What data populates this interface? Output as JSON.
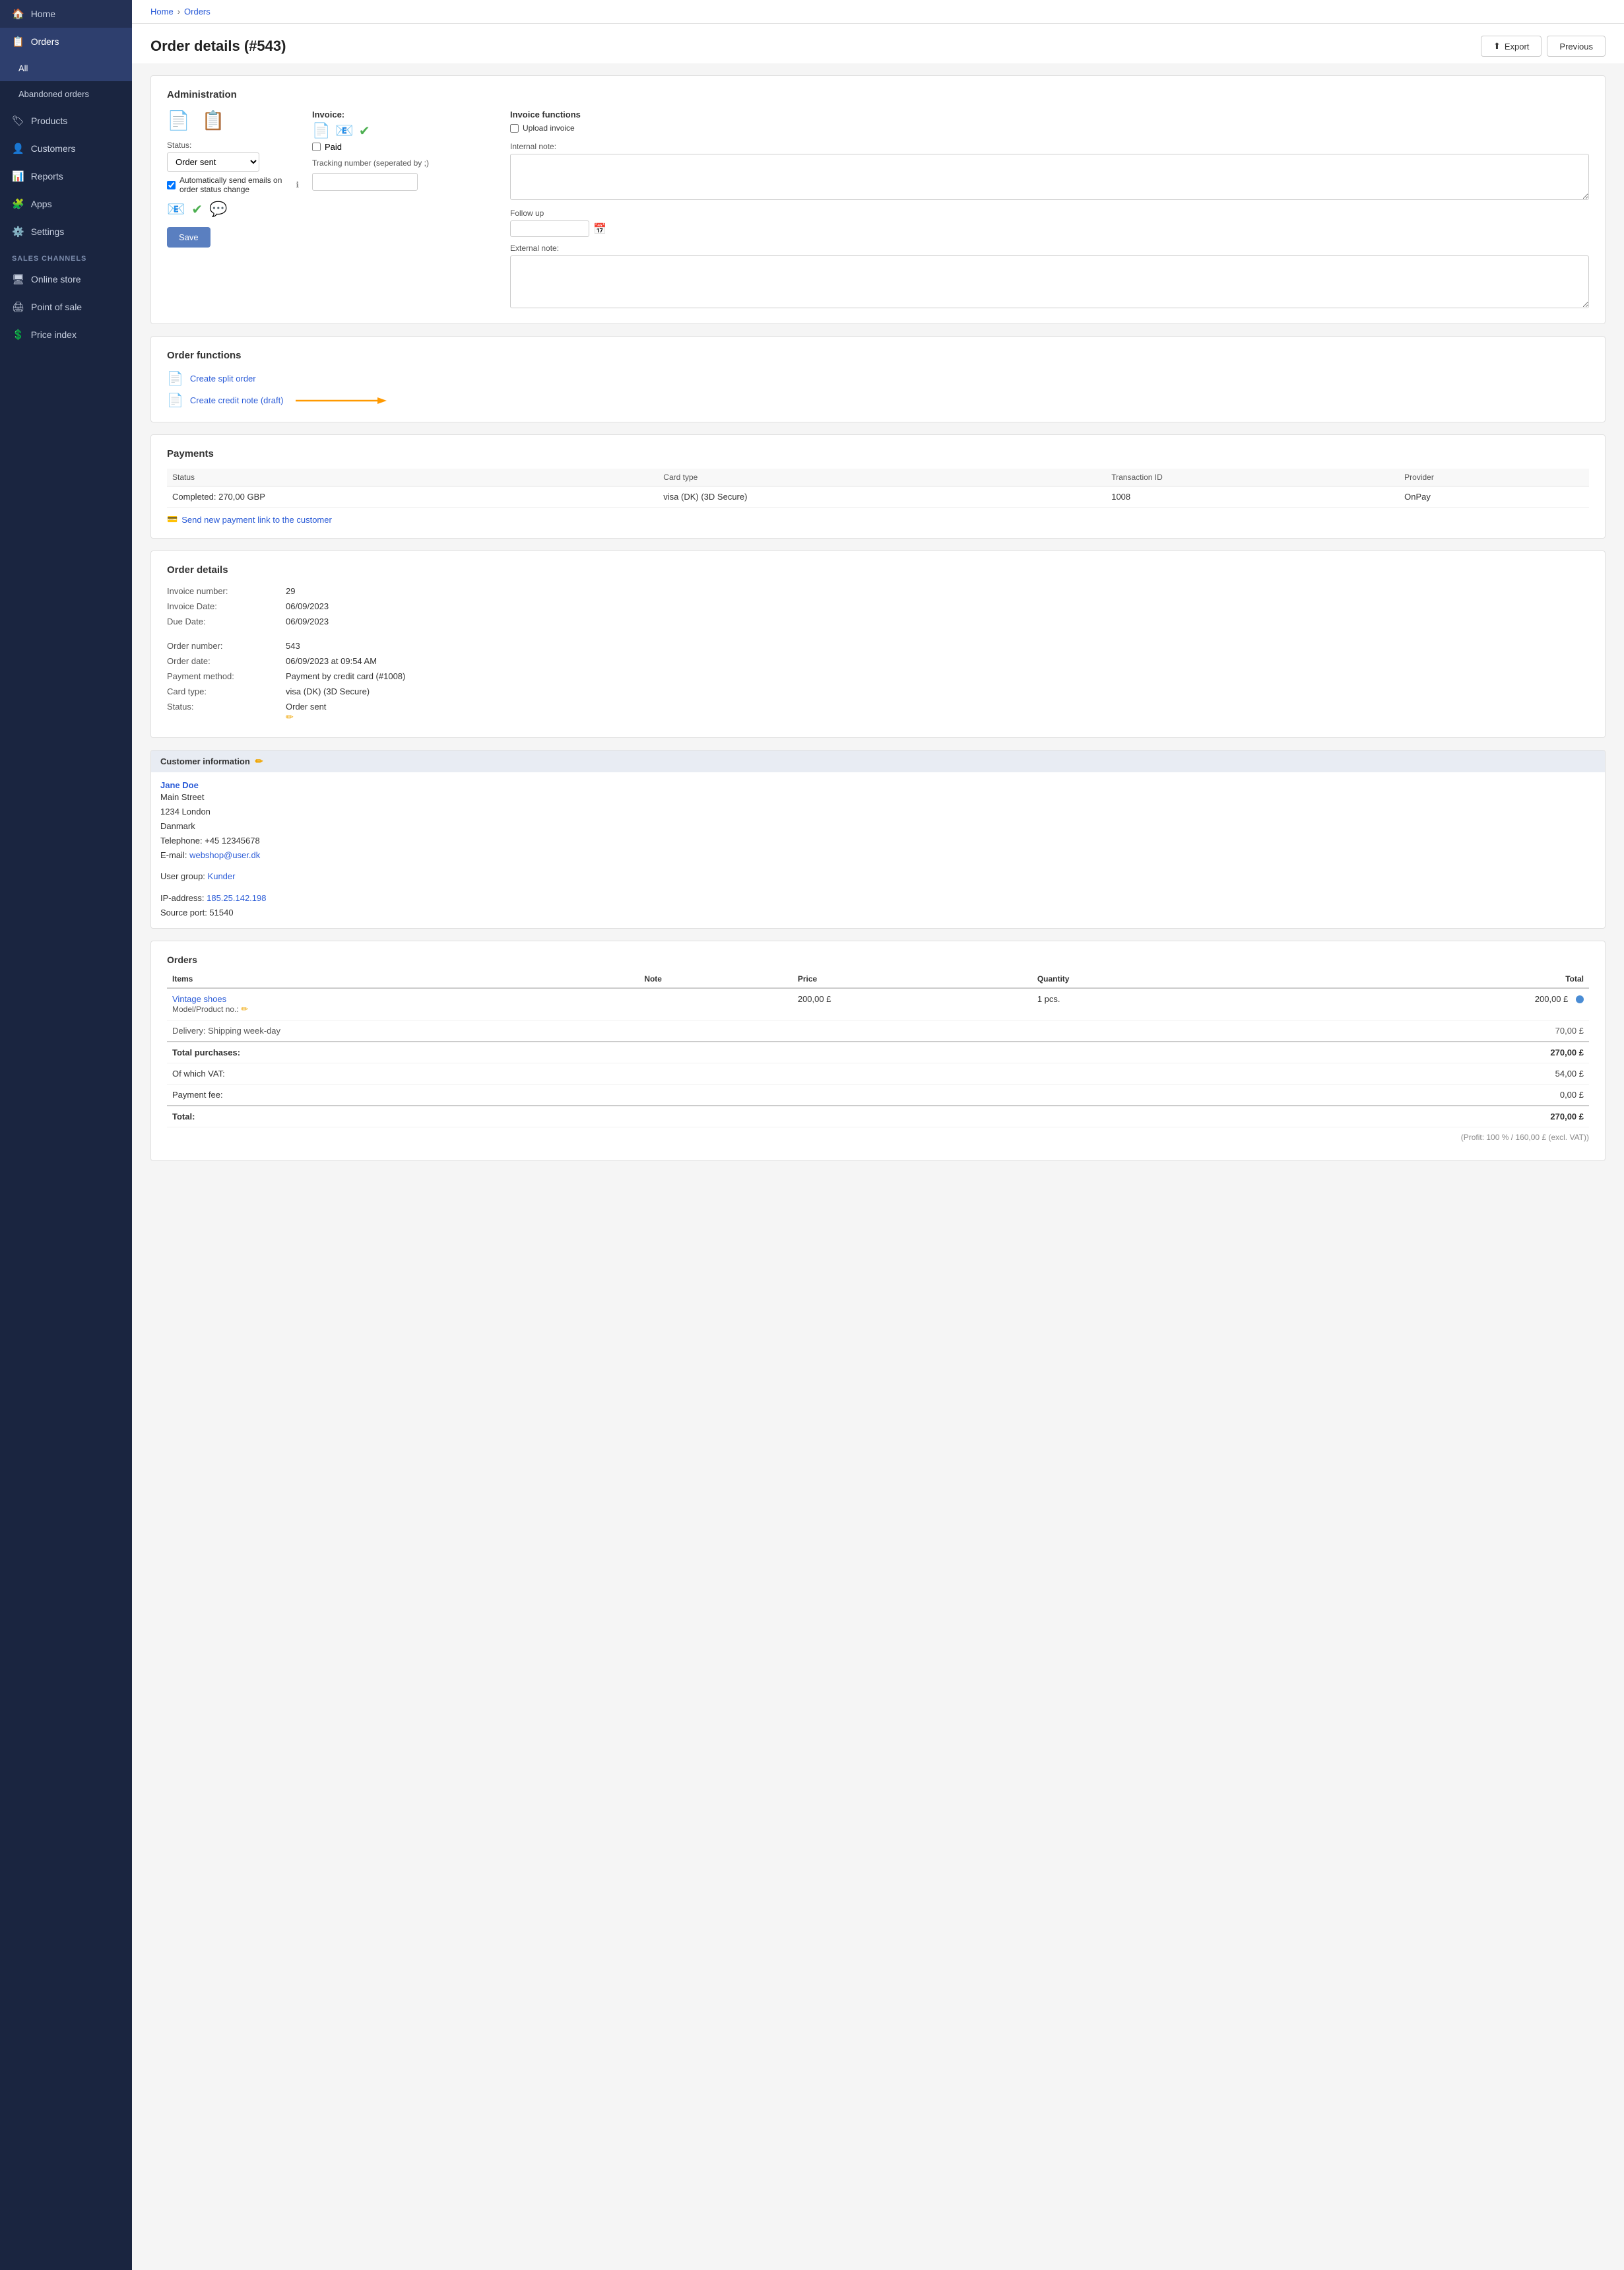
{
  "sidebar": {
    "items": [
      {
        "label": "Home",
        "icon": "🏠",
        "active": false,
        "id": "home"
      },
      {
        "label": "Orders",
        "icon": "📋",
        "active": true,
        "id": "orders"
      },
      {
        "label": "All",
        "icon": "",
        "active": true,
        "sub": true,
        "id": "orders-all"
      },
      {
        "label": "Abandoned orders",
        "icon": "",
        "active": false,
        "sub": true,
        "id": "orders-abandoned"
      },
      {
        "label": "Products",
        "icon": "🏷",
        "active": false,
        "id": "products"
      },
      {
        "label": "Customers",
        "icon": "👤",
        "active": false,
        "id": "customers"
      },
      {
        "label": "Reports",
        "icon": "📊",
        "active": false,
        "id": "reports"
      },
      {
        "label": "Apps",
        "icon": "🧩",
        "active": false,
        "id": "apps"
      },
      {
        "label": "Settings",
        "icon": "⚙️",
        "active": false,
        "id": "settings"
      }
    ],
    "sales_channels_label": "SALES CHANNELS",
    "sales_channels": [
      {
        "label": "Online store",
        "icon": "🖥",
        "id": "online-store"
      },
      {
        "label": "Point of sale",
        "icon": "🖨",
        "id": "point-of-sale"
      },
      {
        "label": "Price index",
        "icon": "💲",
        "id": "price-index"
      }
    ]
  },
  "breadcrumb": {
    "home": "Home",
    "orders": "Orders"
  },
  "header": {
    "title": "Order details (#543)",
    "export_label": "Export",
    "previous_label": "Previous"
  },
  "administration": {
    "section_title": "Administration",
    "status_label": "Status:",
    "status_value": "Order sent",
    "auto_email_label": "Automatically send emails on order status change",
    "invoice_label": "Invoice:",
    "paid_label": "Paid",
    "tracking_label": "Tracking number (seperated by ;)",
    "invoice_functions_label": "Invoice functions",
    "upload_invoice_label": "Upload invoice",
    "internal_note_label": "Internal note:",
    "follow_up_label": "Follow up",
    "external_note_label": "External note:"
  },
  "order_functions": {
    "section_title": "Order functions",
    "create_split_order": "Create split order",
    "create_credit_note": "Create credit note (draft)"
  },
  "payments": {
    "section_title": "Payments",
    "columns": [
      "Status",
      "Card type",
      "Transaction ID",
      "Provider"
    ],
    "row": {
      "status": "Completed: 270,00 GBP",
      "card_type": "visa (DK) (3D Secure)",
      "transaction_id": "1008",
      "provider": "OnPay"
    },
    "send_link_label": "Send new payment link to the customer"
  },
  "order_details": {
    "section_title": "Order details",
    "invoice_number_label": "Invoice number:",
    "invoice_number": "29",
    "invoice_date_label": "Invoice Date:",
    "invoice_date": "06/09/2023",
    "due_date_label": "Due Date:",
    "due_date": "06/09/2023",
    "order_number_label": "Order number:",
    "order_number": "543",
    "order_date_label": "Order date:",
    "order_date": "06/09/2023 at 09:54 AM",
    "payment_method_label": "Payment method:",
    "payment_method": "Payment by credit card (#1008)",
    "card_type_label": "Card type:",
    "card_type": "visa (DK) (3D Secure)",
    "status_label": "Status:",
    "status": "Order sent"
  },
  "customer_info": {
    "section_title": "Customer information",
    "name": "Jane Doe",
    "address1": "Main Street",
    "address2": "1234 London",
    "country": "Danmark",
    "telephone": "Telephone: +45 12345678",
    "email_label": "E-mail:",
    "email": "webshop@user.dk",
    "user_group_label": "User group:",
    "user_group": "Kunder",
    "ip_label": "IP-address:",
    "ip": "185.25.142.198",
    "source_port": "Source port: 51540"
  },
  "orders_table": {
    "section_title": "Orders",
    "columns": [
      "Items",
      "Note",
      "Price",
      "Quantity",
      "Total"
    ],
    "item_name": "Vintage shoes",
    "model_label": "Model/Product no.:",
    "price": "200,00 £",
    "quantity": "1 pcs.",
    "total": "200,00 £",
    "delivery_label": "Delivery: Shipping week-day",
    "delivery_price": "70,00 £",
    "total_purchases_label": "Total purchases:",
    "total_purchases": "270,00 £",
    "vat_label": "Of which VAT:",
    "vat_value": "54,00 £",
    "payment_fee_label": "Payment fee:",
    "payment_fee_value": "0,00 £",
    "total_label": "Total:",
    "total_value": "270,00 £",
    "profit_note": "(Profit: 100 % / 160,00 £ (excl. VAT))"
  }
}
